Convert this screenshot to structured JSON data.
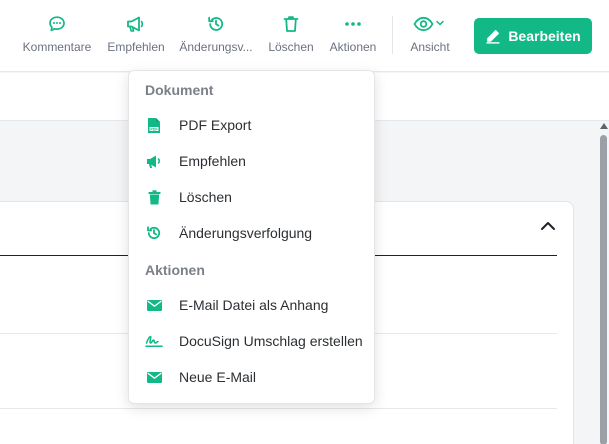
{
  "toolbar": {
    "accent": "#12b886",
    "buttons": [
      {
        "id": "comments",
        "label": "Kommentare",
        "icon": "comment-icon"
      },
      {
        "id": "recommend",
        "label": "Empfehlen",
        "icon": "megaphone-icon"
      },
      {
        "id": "history",
        "label": "Änderungsv...",
        "icon": "history-icon"
      },
      {
        "id": "delete",
        "label": "Löschen",
        "icon": "trash-icon"
      },
      {
        "id": "actions",
        "label": "Aktionen",
        "icon": "more-icon"
      },
      {
        "id": "view",
        "label": "Ansicht",
        "icon": "eye-icon"
      }
    ],
    "edit_label": "Bearbeiten"
  },
  "menu": {
    "sections": [
      {
        "title": "Dokument",
        "items": [
          {
            "label": "PDF Export",
            "icon": "pdf-icon"
          },
          {
            "label": "Empfehlen",
            "icon": "megaphone-icon"
          },
          {
            "label": "Löschen",
            "icon": "trash-icon"
          },
          {
            "label": "Änderungsverfolgung",
            "icon": "history-icon"
          }
        ]
      },
      {
        "title": "Aktionen",
        "items": [
          {
            "label": "E-Mail Datei als Anhang",
            "icon": "envelope-icon"
          },
          {
            "label": "DocuSign Umschlag erstellen",
            "icon": "signature-icon"
          },
          {
            "label": "Neue E-Mail",
            "icon": "envelope-icon"
          }
        ]
      }
    ]
  }
}
